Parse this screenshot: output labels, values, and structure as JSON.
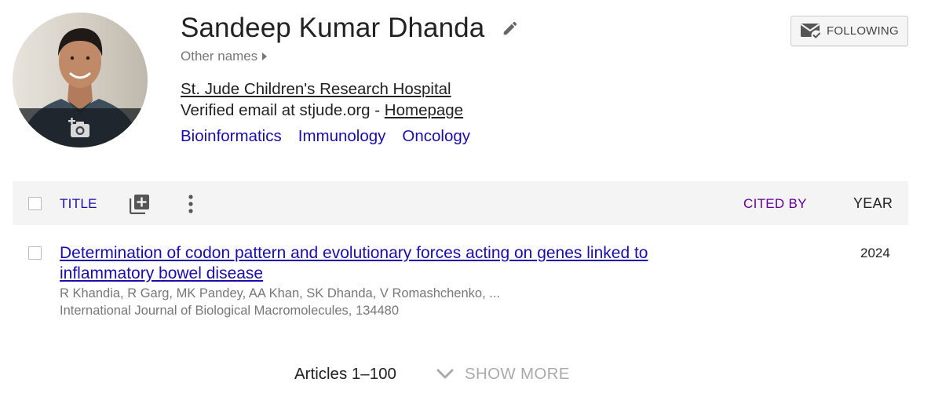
{
  "profile": {
    "name": "Sandeep Kumar Dhanda",
    "other_names": "Other names",
    "affiliation": "St. Jude Children's Research Hospital",
    "email_text": "Verified email at stjude.org - ",
    "homepage_label": "Homepage",
    "interests": [
      "Bioinformatics",
      "Immunology",
      "Oncology"
    ]
  },
  "follow_button": {
    "label": "FOLLOWING"
  },
  "table": {
    "columns": {
      "title": "TITLE",
      "cited_by": "CITED BY",
      "year": "YEAR"
    },
    "articles": [
      {
        "title": "Determination of codon pattern and evolutionary forces acting on genes linked to inflammatory bowel disease",
        "authors": "R Khandia, R Garg, MK Pandey, AA Khan, SK Dhanda, V Romashchenko, ...",
        "venue": "International Journal of Biological Macromolecules, 134480",
        "cited_by": "",
        "year": "2024"
      }
    ]
  },
  "footer": {
    "articles_count": "Articles 1–100",
    "show_more_label": "SHOW MORE"
  },
  "colors": {
    "link": "#1a0dab",
    "cited_by": "#660099",
    "muted": "#777777",
    "header_bg": "#f4f4f4"
  },
  "icons": {
    "edit": "pencil-icon",
    "other_names": "caret-right-icon",
    "follow": "mail-check-icon",
    "photo_upload": "add-photo-icon",
    "add_article": "add-box-icon",
    "more": "more-vertical-icon",
    "show_more": "chevron-down-icon"
  }
}
